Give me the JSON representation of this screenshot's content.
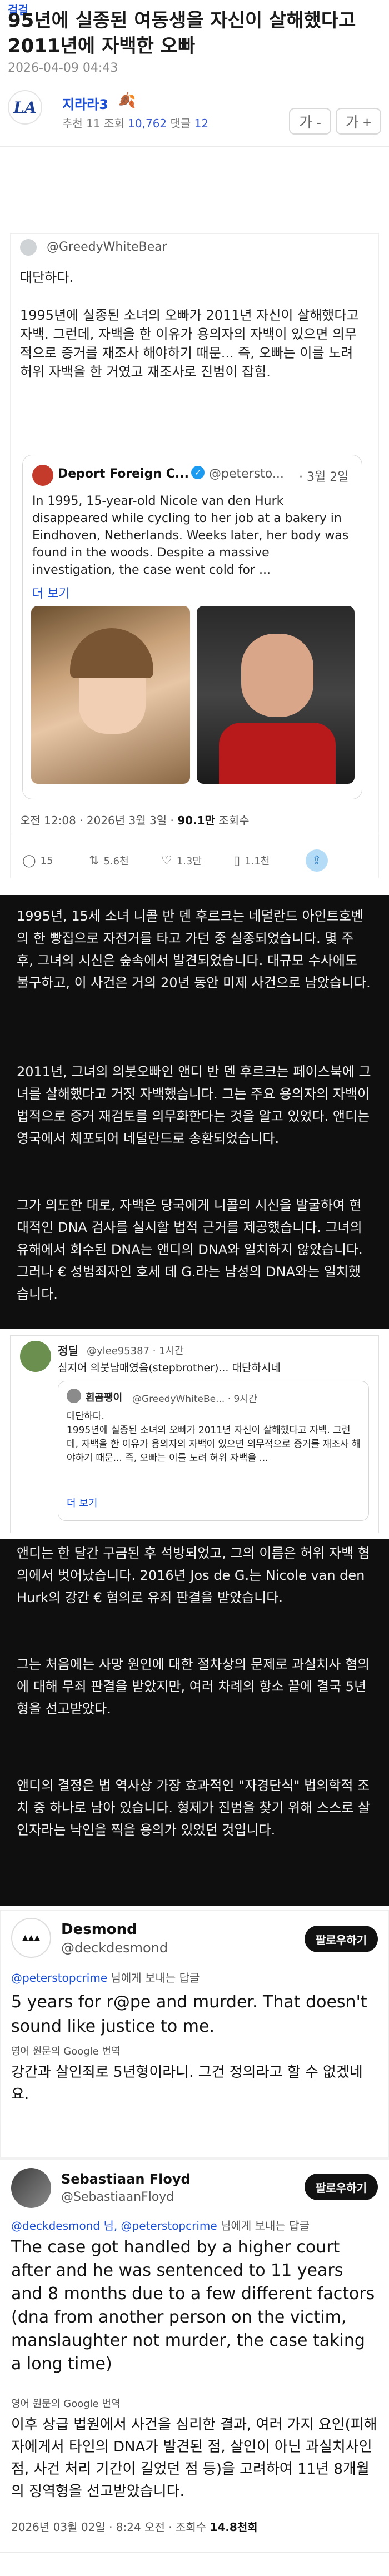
{
  "header": {
    "board_label": "걸걸",
    "title": "95년에 실종된 여동생을 자신이 살해했다고 2011년에 자백한 오빠",
    "date": "2026-04-09 04:43",
    "author": "지라라3",
    "author_badge": "🍂",
    "stats_prefix": "추천",
    "recommend": "11",
    "views_label": "조회",
    "views": "10,762",
    "comments_label": "댓글",
    "comments": "12",
    "font_decrease": "가 -",
    "font_increase": "가 +",
    "team_logo_text": "LA"
  },
  "tweet1": {
    "handle": "@GreedyWhiteBear",
    "text": "대단하다.\n\n1995년에 실종된 소녀의 오빠가 2011년 자신이 살해했다고 자백. 그런데, 자백을 한 이유가 용의자의 자백이 있으면 의무적으로 증거를 재조사 해야하기 때문... 즉, 오빠는 이를 노려 허위 자백을 한 거였고 재조사로 진범이 잡힘.",
    "quote": {
      "name": "Deport Foreign C...",
      "handle": "@petersto...",
      "date": "· 3월 2일",
      "text": "In 1995, 15-year-old Nicole van den Hurk disappeared while cycling to her job at a bakery in Eindhoven, Netherlands. Weeks later, her body was found in the woods. Despite a massive investigation, the case went cold for ...",
      "more": "더 보기"
    },
    "meta_time": "오전 12:08 · 2026년 3월 3일 · ",
    "meta_views": "90.1만",
    "meta_views_label": " 조회수",
    "replies": "15",
    "retweets": "5.6천",
    "likes": "1.3만",
    "bookmarks": "1.1천"
  },
  "dark1": {
    "p1": "1995년, 15세 소녀 니콜 반 덴 후르크는 네덜란드 아인트호벤의 한 빵집으로 자전거를 타고 가던 중 실종되었습니다. 몇 주 후, 그녀의 시신은 숲속에서 발견되었습니다. 대규모 수사에도 불구하고, 이 사건은 거의 20년 동안 미제 사건으로 남았습니다.",
    "p2": "2011년, 그녀의 의붓오빠인 앤디 반 덴 후르크는 페이스북에 그녀를 살해했다고 거짓 자백했습니다. 그는 주요 용의자의 자백이 법적으로 증거 재검토를 의무화한다는 것을 알고 있었다. 앤디는 영국에서 체포되어 네덜란드로 송환되었습니다.",
    "p3": "그가 의도한 대로, 자백은 당국에게 니콜의 시신을 발굴하여 현대적인 DNA 검사를 실시할 법적 근거를 제공했습니다. 그녀의 유해에서 회수된 DNA는 앤디의 DNA와 일치하지 않았습니다. 그러나 € 성범죄자인 호세 데 G.라는 남성의 DNA와는 일치했습니다."
  },
  "tweet2": {
    "name": "정딜",
    "handle": "@ylee95387 · 1시간",
    "text": "심지어 의붓남매였음(stepbrother)... 대단하시네",
    "quote": {
      "name": "흰곰팽이",
      "handle": "@GreedyWhiteBe... · 9시간",
      "text": "대단하다.\n1995년에 실종된 소녀의 오빠가 2011년 자신이 살해했다고 자백. 그런데, 자백을 한 이유가 용의자의 자백이 있으면 의무적으로 증거를 재조사 해야하기 때문... 즉, 오빠는 이를 노려 허위 자백을 ...",
      "more": "더 보기"
    }
  },
  "dark2": {
    "p1": "앤디는 한 달간 구금된 후 석방되었고, 그의 이름은 허위 자백 혐의에서 벗어났습니다. 2016년 Jos de G.는 Nicole van den Hurk의 강간 € 혐의로 유죄 판결을 받았습니다.",
    "p2": "그는 처음에는 사망 원인에 대한 절차상의 문제로 과실치사 혐의에 대해 무죄 판결을 받았지만, 여러 차례의 항소 끝에 결국 5년형을 선고받았다.",
    "p3": "앤디의 결정은 법 역사상 가장 효과적인 \"자경단식\" 법의학적 조치 중 하나로 남아 있습니다. 형제가 진범을 찾기 위해 스스로 살인자라는 낙인을 찍을 용의가 있었던 것입니다."
  },
  "tweet3": {
    "name": "Desmond",
    "handle": "@deckdesmond",
    "follow": "팔로우하기",
    "reply_to": "@peterstopcrime",
    "reply_suffix": " 님에게 보내는 답글",
    "text": "5 years for r@pe and murder. That doesn't sound like justice to me.",
    "translation_label": "영어 원문의 Google 번역",
    "translation": "강간과 살인죄로 5년형이라니. 그건 정의라고 할 수 없겠네요."
  },
  "tweet4": {
    "name": "Sebastiaan Floyd",
    "handle": "@SebastiaanFloyd",
    "follow": "팔로우하기",
    "reply_to": "@deckdesmond 님, @peterstopcrime",
    "reply_suffix": " 님에게 보내는 답글",
    "text": "The case got handled by a higher court after and he was sentenced to 11 years and 8 months due to a few different factors (dna from another person on the victim, manslaughter not murder, the case taking a long time)",
    "translation_label": "영어 원문의 Google 번역",
    "translation": "이후 상급 법원에서 사건을 심리한 결과, 여러 가지 요인(피해자에게서 타인의 DNA가 발견된 점, 살인이 아닌 과실치사인 점, 사건 처리 기간이 길었던 점 등)을 고려하여 11년 8개월의 징역형을 선고받았습니다.",
    "meta": "2026년 03월 02일 · 8:24 오전 · 조회수 ",
    "meta_views": "14.8천회"
  },
  "colors": {
    "accent": "#1a4fd6",
    "dark_panel": "#0f0f0f"
  }
}
